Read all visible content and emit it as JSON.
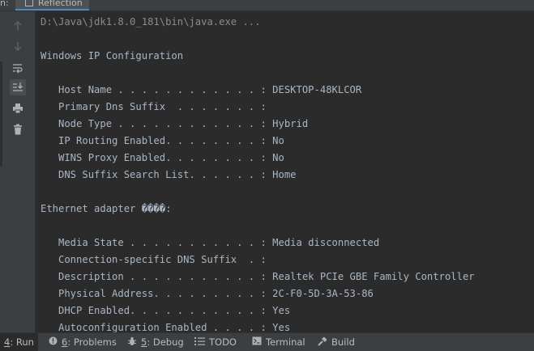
{
  "window": {
    "run_prefix": "n:",
    "tab_title": "Reflection"
  },
  "gutter": {
    "icons": [
      "up-arrow-icon",
      "down-arrow-icon",
      "soft-wrap-icon",
      "scroll-to-end-icon",
      "print-icon",
      "trash-icon"
    ]
  },
  "console": {
    "lines": [
      "D:\\Java\\jdk1.8.0_181\\bin\\java.exe ...",
      "",
      "Windows IP Configuration",
      "",
      "   Host Name . . . . . . . . . . . . : DESKTOP-48KLCOR",
      "   Primary Dns Suffix  . . . . . . . :",
      "   Node Type . . . . . . . . . . . . : Hybrid",
      "   IP Routing Enabled. . . . . . . . : No",
      "   WINS Proxy Enabled. . . . . . . . : No",
      "   DNS Suffix Search List. . . . . . : Home",
      "",
      "Ethernet adapter ����:",
      "",
      "   Media State . . . . . . . . . . . : Media disconnected",
      "   Connection-specific DNS Suffix  . :",
      "   Description . . . . . . . . . . . : Realtek PCIe GBE Family Controller",
      "   Physical Address. . . . . . . . . : 2C-F0-5D-3A-53-86",
      "   DHCP Enabled. . . . . . . . . . . : Yes",
      "   Autoconfiguration Enabled . . . . : Yes"
    ]
  },
  "bottom_tabs": [
    {
      "num": "4",
      "label": ": Run",
      "icon": "run-icon"
    },
    {
      "num": "6",
      "label": ": Problems",
      "icon": "problems-icon"
    },
    {
      "num": "5",
      "label": ": Debug",
      "icon": "debug-icon"
    },
    {
      "num": "",
      "label": "TODO",
      "icon": "todo-icon"
    },
    {
      "num": "",
      "label": "Terminal",
      "icon": "terminal-icon"
    },
    {
      "num": "",
      "label": "Build",
      "icon": "build-icon"
    }
  ],
  "colors": {
    "background": "#2b2b2b",
    "panel": "#3c3f41",
    "text": "#a9b7c6",
    "command_text": "#8c8c8c",
    "accent": "#4a88c7"
  }
}
